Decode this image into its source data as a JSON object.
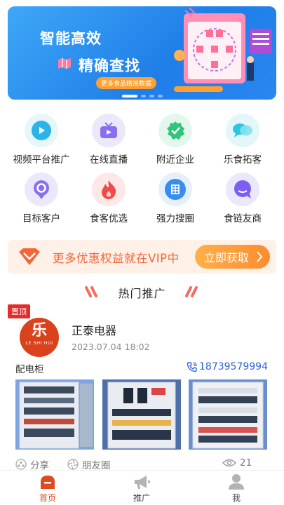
{
  "banner": {
    "headline_1": "智能高效",
    "headline_2": "精确查找",
    "pill": "更多食品精准数据",
    "dots": 4,
    "active_dot": 0
  },
  "grid": {
    "items": [
      {
        "label": "视频平台推广",
        "icon": "video-play-icon",
        "bg": "#e6f6fb",
        "color": "#2bb4e8"
      },
      {
        "label": "在线直播",
        "icon": "tv-live-icon",
        "bg": "#ece8fb",
        "color": "#8a6ef2"
      },
      {
        "label": "附近企业",
        "icon": "badge-check-icon",
        "bg": "#e4f7ec",
        "color": "#2fc57a"
      },
      {
        "label": "乐食拓客",
        "icon": "chat-bubbles-icon",
        "bg": "#e3f7fb",
        "color": "#2bc6e0"
      },
      {
        "label": "目标客户",
        "icon": "location-target-icon",
        "bg": "#ece8fb",
        "color": "#8a6ef2"
      },
      {
        "label": "食客优选",
        "icon": "flame-icon",
        "bg": "#fde8e8",
        "color": "#f04b4b"
      },
      {
        "label": "强力搜圈",
        "icon": "search-circle-icon",
        "bg": "#e4f0fb",
        "color": "#3a8df0"
      },
      {
        "label": "食链友商",
        "icon": "chat-bubble-icon",
        "bg": "#ece8fb",
        "color": "#7d5ef2"
      }
    ]
  },
  "vip": {
    "text": "更多优惠权益就在VIP中",
    "button": "立即获取"
  },
  "section": {
    "title": "热门推广"
  },
  "post": {
    "badge": "置顶",
    "logo_char": "乐",
    "logo_sub": "LE SHI HUI",
    "company": "正泰电器",
    "date": "2023.07.04 18:02",
    "category": "配电柜",
    "phone": "18739579994",
    "share_label": "分享",
    "moments_label": "朋友圈",
    "views": "21"
  },
  "tabs": [
    {
      "label": "首页",
      "icon": "home-icon",
      "active": true
    },
    {
      "label": "推广",
      "icon": "megaphone-icon",
      "active": false
    },
    {
      "label": "我",
      "icon": "user-icon",
      "active": false
    }
  ],
  "colors": {
    "accent": "#e04a1e",
    "banner": "#2a86f0",
    "vip_text": "#f2673a",
    "vip_button": "#ff9a38",
    "phone": "#2f63d6",
    "badge": "#e62b2b"
  }
}
